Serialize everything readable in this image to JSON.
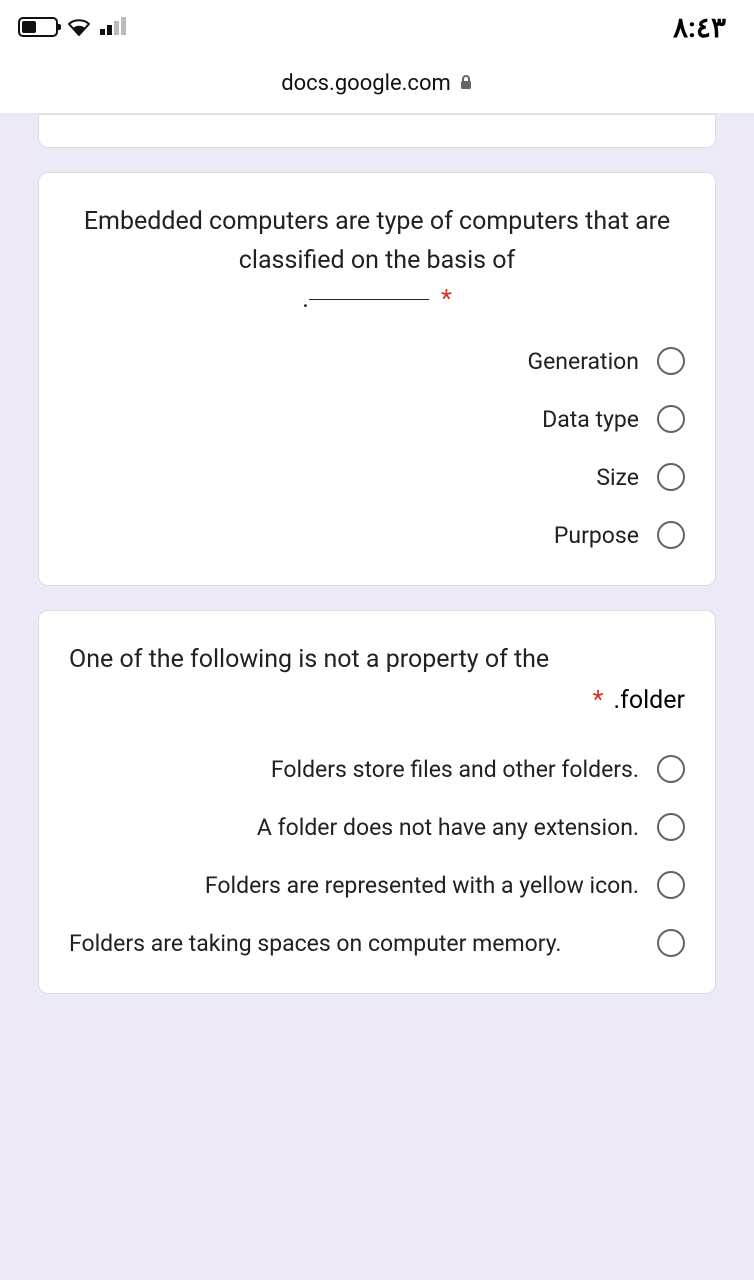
{
  "status": {
    "time": "٨:٤٣"
  },
  "url": "docs.google.com",
  "questions": [
    {
      "prompt_pre": "Embedded computers are type of computers that are classified on the basis of",
      "required_mark": "*",
      "blank_trailing_dot": ".",
      "options": [
        "Generation",
        "Data type",
        "Size",
        "Purpose"
      ]
    },
    {
      "prompt_line1": "One of the following is not a property of the",
      "suffix_text": ".folder",
      "required_mark": "*",
      "options": [
        "Folders store files and other folders.",
        "A folder does not have any extension.",
        "Folders are represented with a yellow icon.",
        "Folders are taking spaces on computer memory."
      ]
    }
  ]
}
